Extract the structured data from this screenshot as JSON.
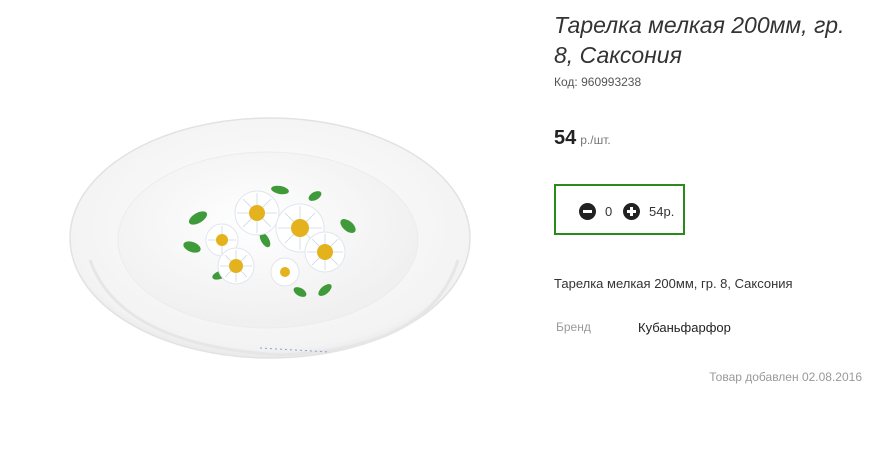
{
  "product": {
    "title": "Тарелка мелкая 200мм, гр. 8, Саксония",
    "code_label": "Код:",
    "code_value": "960993238",
    "price_value": "54",
    "price_unit": "р./шт.",
    "quantity": "0",
    "line_total": "54р.",
    "description": "Тарелка мелкая 200мм, гр. 8, Саксония",
    "brand_label": "Бренд",
    "brand_value": "Кубаньфарфор",
    "added_text": "Товар добавлен 02.08.2016"
  },
  "icons": {
    "decrease": "minus-circle-icon",
    "increase": "plus-circle-icon"
  },
  "colors": {
    "qty_border": "#2a8a1c",
    "plate": "#ffffff",
    "leaf": "#3f9a3a",
    "flower_center": "#e3b21c"
  }
}
